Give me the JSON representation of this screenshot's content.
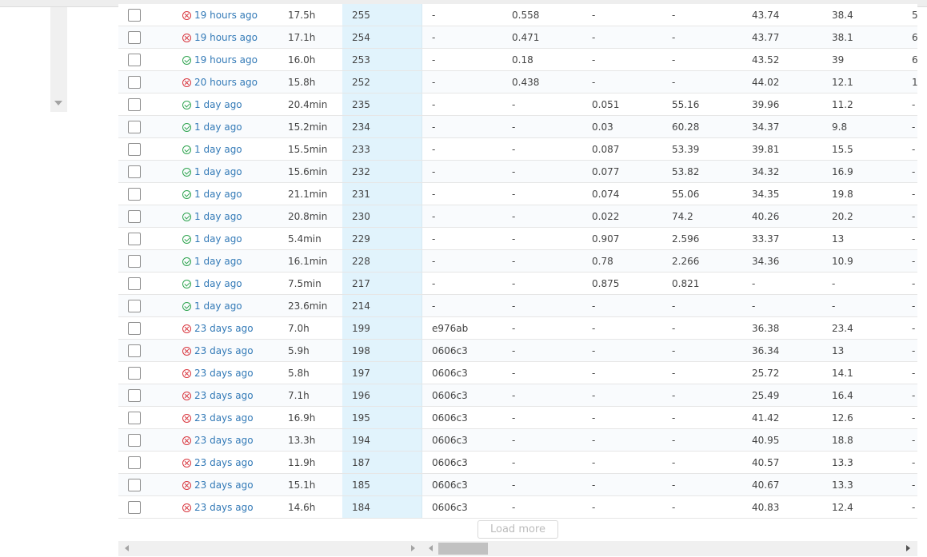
{
  "rows": [
    {
      "status": "fail",
      "time": "19 hours ago",
      "duration": "17.5h",
      "id": "255",
      "commit": "-",
      "m1": "0.558",
      "m2": "-",
      "m3": "-",
      "m4": "43.74",
      "m5": "38.4",
      "m6": "5"
    },
    {
      "status": "fail",
      "time": "19 hours ago",
      "duration": "17.1h",
      "id": "254",
      "commit": "-",
      "m1": "0.471",
      "m2": "-",
      "m3": "-",
      "m4": "43.77",
      "m5": "38.1",
      "m6": "6"
    },
    {
      "status": "ok",
      "time": "19 hours ago",
      "duration": "16.0h",
      "id": "253",
      "commit": "-",
      "m1": "0.18",
      "m2": "-",
      "m3": "-",
      "m4": "43.52",
      "m5": "39",
      "m6": "6"
    },
    {
      "status": "fail",
      "time": "20 hours ago",
      "duration": "15.8h",
      "id": "252",
      "commit": "-",
      "m1": "0.438",
      "m2": "-",
      "m3": "-",
      "m4": "44.02",
      "m5": "12.1",
      "m6": "1"
    },
    {
      "status": "ok",
      "time": "1 day ago",
      "duration": "20.4min",
      "id": "235",
      "commit": "-",
      "m1": "-",
      "m2": "0.051",
      "m3": "55.16",
      "m4": "39.96",
      "m5": "11.2",
      "m6": "-"
    },
    {
      "status": "ok",
      "time": "1 day ago",
      "duration": "15.2min",
      "id": "234",
      "commit": "-",
      "m1": "-",
      "m2": "0.03",
      "m3": "60.28",
      "m4": "34.37",
      "m5": "9.8",
      "m6": "-"
    },
    {
      "status": "ok",
      "time": "1 day ago",
      "duration": "15.5min",
      "id": "233",
      "commit": "-",
      "m1": "-",
      "m2": "0.087",
      "m3": "53.39",
      "m4": "39.81",
      "m5": "15.5",
      "m6": "-"
    },
    {
      "status": "ok",
      "time": "1 day ago",
      "duration": "15.6min",
      "id": "232",
      "commit": "-",
      "m1": "-",
      "m2": "0.077",
      "m3": "53.82",
      "m4": "34.32",
      "m5": "16.9",
      "m6": "-"
    },
    {
      "status": "ok",
      "time": "1 day ago",
      "duration": "21.1min",
      "id": "231",
      "commit": "-",
      "m1": "-",
      "m2": "0.074",
      "m3": "55.06",
      "m4": "34.35",
      "m5": "19.8",
      "m6": "-"
    },
    {
      "status": "ok",
      "time": "1 day ago",
      "duration": "20.8min",
      "id": "230",
      "commit": "-",
      "m1": "-",
      "m2": "0.022",
      "m3": "74.2",
      "m4": "40.26",
      "m5": "20.2",
      "m6": "-"
    },
    {
      "status": "ok",
      "time": "1 day ago",
      "duration": "5.4min",
      "id": "229",
      "commit": "-",
      "m1": "-",
      "m2": "0.907",
      "m3": "2.596",
      "m4": "33.37",
      "m5": "13",
      "m6": "-"
    },
    {
      "status": "ok",
      "time": "1 day ago",
      "duration": "16.1min",
      "id": "228",
      "commit": "-",
      "m1": "-",
      "m2": "0.78",
      "m3": "2.266",
      "m4": "34.36",
      "m5": "10.9",
      "m6": "-"
    },
    {
      "status": "ok",
      "time": "1 day ago",
      "duration": "7.5min",
      "id": "217",
      "commit": "-",
      "m1": "-",
      "m2": "0.875",
      "m3": "0.821",
      "m4": "-",
      "m5": "-",
      "m6": "-"
    },
    {
      "status": "ok",
      "time": "1 day ago",
      "duration": "23.6min",
      "id": "214",
      "commit": "-",
      "m1": "-",
      "m2": "-",
      "m3": "-",
      "m4": "-",
      "m5": "-",
      "m6": "-"
    },
    {
      "status": "fail",
      "time": "23 days ago",
      "duration": "7.0h",
      "id": "199",
      "commit": "e976ab",
      "m1": "-",
      "m2": "-",
      "m3": "-",
      "m4": "36.38",
      "m5": "23.4",
      "m6": "-"
    },
    {
      "status": "fail",
      "time": "23 days ago",
      "duration": "5.9h",
      "id": "198",
      "commit": "0606c3",
      "m1": "-",
      "m2": "-",
      "m3": "-",
      "m4": "36.34",
      "m5": "13",
      "m6": "-"
    },
    {
      "status": "fail",
      "time": "23 days ago",
      "duration": "5.8h",
      "id": "197",
      "commit": "0606c3",
      "m1": "-",
      "m2": "-",
      "m3": "-",
      "m4": "25.72",
      "m5": "14.1",
      "m6": "-"
    },
    {
      "status": "fail",
      "time": "23 days ago",
      "duration": "7.1h",
      "id": "196",
      "commit": "0606c3",
      "m1": "-",
      "m2": "-",
      "m3": "-",
      "m4": "25.49",
      "m5": "16.4",
      "m6": "-"
    },
    {
      "status": "fail",
      "time": "23 days ago",
      "duration": "16.9h",
      "id": "195",
      "commit": "0606c3",
      "m1": "-",
      "m2": "-",
      "m3": "-",
      "m4": "41.42",
      "m5": "12.6",
      "m6": "-"
    },
    {
      "status": "fail",
      "time": "23 days ago",
      "duration": "13.3h",
      "id": "194",
      "commit": "0606c3",
      "m1": "-",
      "m2": "-",
      "m3": "-",
      "m4": "40.95",
      "m5": "18.8",
      "m6": "-"
    },
    {
      "status": "fail",
      "time": "23 days ago",
      "duration": "11.9h",
      "id": "187",
      "commit": "0606c3",
      "m1": "-",
      "m2": "-",
      "m3": "-",
      "m4": "40.57",
      "m5": "13.3",
      "m6": "-"
    },
    {
      "status": "fail",
      "time": "23 days ago",
      "duration": "15.1h",
      "id": "185",
      "commit": "0606c3",
      "m1": "-",
      "m2": "-",
      "m3": "-",
      "m4": "40.67",
      "m5": "13.3",
      "m6": "-"
    },
    {
      "status": "fail",
      "time": "23 days ago",
      "duration": "14.6h",
      "id": "184",
      "commit": "0606c3",
      "m1": "-",
      "m2": "-",
      "m3": "-",
      "m4": "40.83",
      "m5": "12.4",
      "m6": "-"
    }
  ],
  "load_more_label": "Load more",
  "colors": {
    "ok": "#2ea44f",
    "fail": "#d9363e",
    "link": "#337ab7",
    "highlight_column": "#e1f3fc"
  }
}
